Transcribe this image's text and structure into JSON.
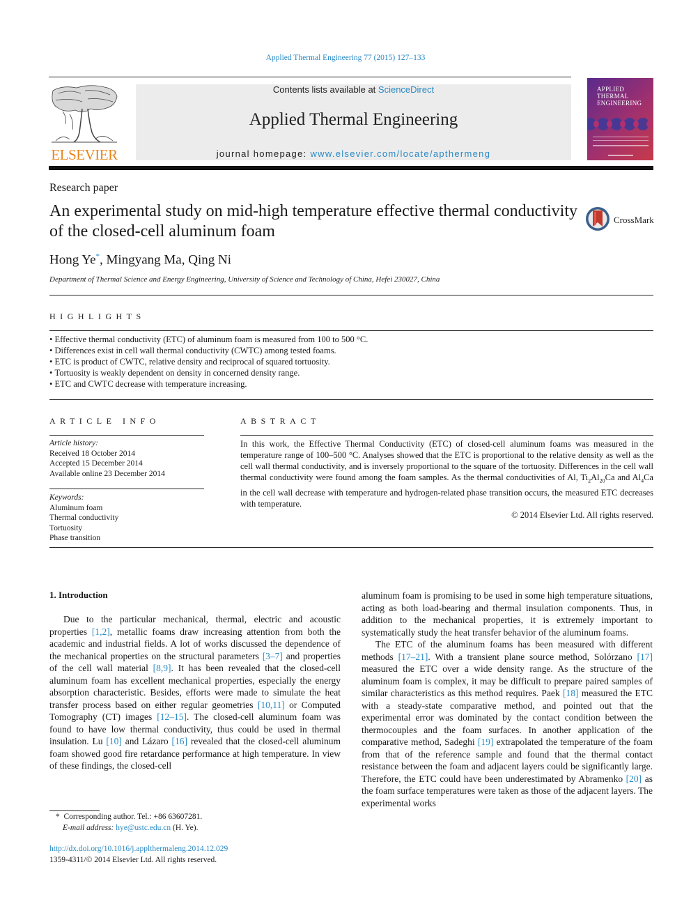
{
  "running_head": "Applied Thermal Engineering 77 (2015) 127–133",
  "header": {
    "publisher_logo_text": "ELSEVIER",
    "contents_prefix": "Contents lists available at ",
    "contents_link": "ScienceDirect",
    "journal_name": "Applied Thermal Engineering",
    "homepage_prefix": "journal homepage: ",
    "homepage_link": "www.elsevier.com/locate/apthermeng",
    "cover_title_lines": [
      "Applied",
      "Thermal",
      "Engineering"
    ]
  },
  "article": {
    "type": "Research paper",
    "title": "An experimental study on mid-high temperature effective thermal conductivity of the closed-cell aluminum foam",
    "crossmark_label": "CrossMark",
    "authors": [
      {
        "name": "Hong Ye",
        "mark": "*"
      },
      {
        "name": "Mingyang Ma"
      },
      {
        "name": "Qing Ni"
      }
    ],
    "author_separator": ", ",
    "affiliation": "Department of Thermal Science and Energy Engineering, University of Science and Technology of China, Hefei 230027, China"
  },
  "highlights": {
    "heading": "HIGHLIGHTS",
    "items": [
      "Effective thermal conductivity (ETC) of aluminum foam is measured from 100 to 500 °C.",
      "Differences exist in cell wall thermal conductivity (CWTC) among tested foams.",
      "ETC is product of CWTC, relative density and reciprocal of squared tortuosity.",
      "Tortuosity is weakly dependent on density in concerned density range.",
      "ETC and CWTC decrease with temperature increasing."
    ]
  },
  "article_info": {
    "heading": "ARTICLE INFO",
    "history_label": "Article history:",
    "history": [
      "Received 18 October 2014",
      "Accepted 15 December 2014",
      "Available online 23 December 2014"
    ],
    "keywords_label": "Keywords:",
    "keywords": [
      "Aluminum foam",
      "Thermal conductivity",
      "Tortuosity",
      "Phase transition"
    ]
  },
  "abstract": {
    "heading": "ABSTRACT",
    "part1": "In this work, the Effective Thermal Conductivity (ETC) of closed-cell aluminum foams was measured in the temperature range of 100–500 °C. Analyses showed that the ETC is proportional to the relative density as well as the cell wall thermal conductivity, and is inversely proportional to the square of the tortuosity. Differences in the cell wall thermal conductivity were found among the foam samples. As the thermal conductivities of Al, Ti",
    "sub1": "2",
    "part2": "Al",
    "sub2": "20",
    "part3": "Ca and Al",
    "sub3": "4",
    "part4": "Ca in the cell wall decrease with temperature and hydrogen-related phase transition occurs, the measured ETC decreases with temperature.",
    "copyright": "© 2014 Elsevier Ltd. All rights reserved."
  },
  "introduction": {
    "heading": "1.  Introduction",
    "p1": [
      {
        "t": "Due to the particular mechanical, thermal, electric and acoustic properties "
      },
      {
        "ref": "[1,2]"
      },
      {
        "t": ", metallic foams draw increasing attention from both the academic and industrial fields. A lot of works discussed the dependence of the mechanical properties on the structural parameters "
      },
      {
        "ref": "[3–7]"
      },
      {
        "t": " and properties of the cell wall material "
      },
      {
        "ref": "[8,9]"
      },
      {
        "t": ". It has been revealed that the closed-cell aluminum foam has excellent mechanical properties, especially the energy absorption characteristic. Besides, efforts were made to simulate the heat transfer process based on either regular geometries "
      },
      {
        "ref": "[10,11]"
      },
      {
        "t": " or Computed Tomography (CT) images "
      },
      {
        "ref": "[12–15]"
      },
      {
        "t": ". The closed-cell aluminum foam was found to have low thermal conductivity, thus could be used in thermal insulation. Lu "
      },
      {
        "ref": "[10]"
      },
      {
        "t": " and Lázaro "
      },
      {
        "ref": "[16]"
      },
      {
        "t": " revealed that the closed-cell aluminum foam showed good fire retardance performance at high temperature. In view of these findings, the closed-cell"
      }
    ],
    "p1_cont": [
      {
        "t": "aluminum foam is promising to be used in some high temperature situations, acting as both load-bearing and thermal insulation components. Thus, in addition to the mechanical properties, it is extremely important to systematically study the heat transfer behavior of the aluminum foams."
      }
    ],
    "p2": [
      {
        "t": "The ETC of the aluminum foams has been measured with different methods "
      },
      {
        "ref": "[17–21]"
      },
      {
        "t": ". With a transient plane source method, Solórzano "
      },
      {
        "ref": "[17]"
      },
      {
        "t": " measured the ETC over a wide density range. As the structure of the aluminum foam is complex, it may be difficult to prepare paired samples of similar characteristics as this method requires. Paek "
      },
      {
        "ref": "[18]"
      },
      {
        "t": " measured the ETC with a steady-state comparative method, and pointed out that the experimental error was dominated by the contact condition between the thermocouples and the foam surfaces. In another application of the comparative method, Sadeghi "
      },
      {
        "ref": "[19]"
      },
      {
        "t": " extrapolated the temperature of the foam from that of the reference sample and found that the thermal contact resistance between the foam and adjacent layers could be significantly large. Therefore, the ETC could have been underestimated by Abramenko "
      },
      {
        "ref": "[20]"
      },
      {
        "t": " as the foam surface temperatures were taken as those of the adjacent layers. The experimental works"
      }
    ]
  },
  "footnote": {
    "mark": "*",
    "corresponding": "Corresponding author. Tel.: +86 63607281.",
    "email_label": "E-mail address: ",
    "email": "hye@ustc.edu.cn",
    "email_suffix": " (H. Ye)."
  },
  "doi": {
    "link": "http://dx.doi.org/10.1016/j.applthermaleng.2014.12.029",
    "issn_line": "1359-4311/© 2014 Elsevier Ltd. All rights reserved."
  },
  "colors": {
    "link": "#2a8ac4",
    "elsevier_orange": "#e8861c",
    "header_box": "#ececec"
  }
}
